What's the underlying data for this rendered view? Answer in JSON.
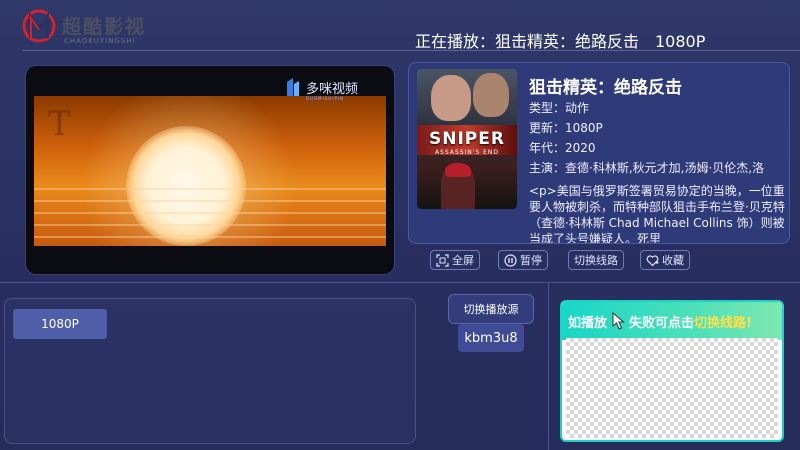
{
  "header": {
    "logo_text": "超酷影视",
    "logo_sub": "CHAOKUYINGSHI",
    "now_playing": "正在播放：狙击精英：绝路反击　1080P"
  },
  "player": {
    "watermark_text": "多咪视频",
    "watermark_sub": "DUOMISHIPIN"
  },
  "movie": {
    "poster_title": "SNIPER",
    "poster_subtitle": "ASSASSIN'S END",
    "title": "狙击精英：绝路反击",
    "type": "类型：动作",
    "update": "更新：1080P",
    "year": "年代：2020",
    "cast": "主演：查德·科林斯,秋元才加,汤姆·贝伦杰,洛",
    "description": "<p>美国与俄罗斯签署贸易协定的当晚，一位重要人物被刺杀，而特种部队狙击手布兰登·贝克特（查德·科林斯 Chad Michael Collins 饰）则被当成了头号嫌疑人。死里"
  },
  "controls": {
    "fullscreen": "全屏",
    "pause": "暂停",
    "switch_line": "切换线路",
    "favorite": "收藏"
  },
  "quality": {
    "options": [
      "1080P"
    ]
  },
  "source": {
    "header": "切换播放源",
    "options": [
      "kbm3u8"
    ]
  },
  "tip": {
    "part1": "如播放",
    "part2": "失败可点击",
    "part3": "切换线路!"
  },
  "colors": {
    "background": "#2a3163",
    "accent_teal": "#1fd1c4",
    "highlight_yellow": "#ffe04b",
    "button_blue": "#4e5ea8",
    "logo_red": "#d0242c"
  }
}
